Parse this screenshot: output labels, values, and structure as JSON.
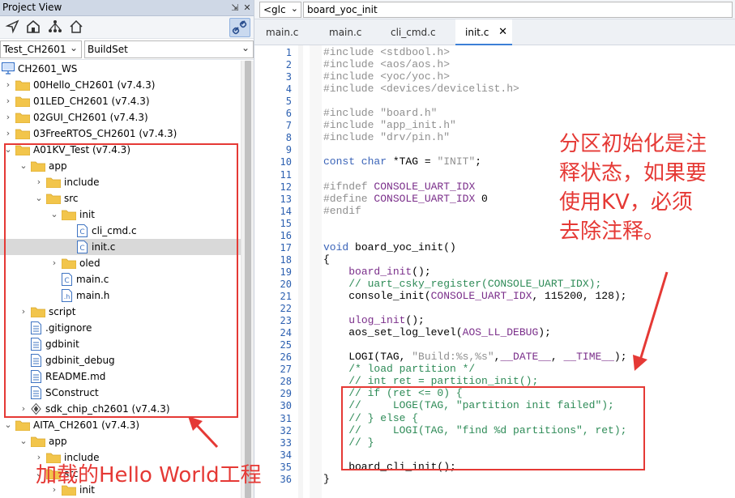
{
  "project_view": {
    "title": "Project View",
    "project_select": "Test_CH2601",
    "build_select": "BuildSet",
    "icons": [
      "pin-icon",
      "home-icon",
      "hierarchy-icon",
      "house-icon",
      "link-editor-icon"
    ]
  },
  "tree": [
    {
      "label": "CH2601_WS",
      "kind": "workspace",
      "depth": 0
    },
    {
      "label": "00Hello_CH2601 (v7.4.3)",
      "kind": "folder",
      "depth": 0,
      "expanded": false
    },
    {
      "label": "01LED_CH2601 (v7.4.3)",
      "kind": "folder",
      "depth": 0,
      "expanded": false
    },
    {
      "label": "02GUI_CH2601 (v7.4.3)",
      "kind": "folder",
      "depth": 0,
      "expanded": false
    },
    {
      "label": "03FreeRTOS_CH2601 (v7.4.3)",
      "kind": "folder",
      "depth": 0,
      "expanded": false
    },
    {
      "label": "A01KV_Test (v7.4.3)",
      "kind": "folder",
      "depth": 0,
      "expanded": true
    },
    {
      "label": "app",
      "kind": "folder",
      "depth": 1,
      "expanded": true
    },
    {
      "label": "include",
      "kind": "folder",
      "depth": 2,
      "expanded": false
    },
    {
      "label": "src",
      "kind": "folder",
      "depth": 2,
      "expanded": true
    },
    {
      "label": "init",
      "kind": "folder",
      "depth": 3,
      "expanded": true
    },
    {
      "label": "cli_cmd.c",
      "kind": "cfile",
      "depth": 4
    },
    {
      "label": "init.c",
      "kind": "cfile",
      "depth": 4,
      "selected": true
    },
    {
      "label": "oled",
      "kind": "folder",
      "depth": 3,
      "expanded": false
    },
    {
      "label": "main.c",
      "kind": "cfile",
      "depth": 3
    },
    {
      "label": "main.h",
      "kind": "hfile",
      "depth": 3
    },
    {
      "label": "script",
      "kind": "folder",
      "depth": 1,
      "expanded": false
    },
    {
      "label": ".gitignore",
      "kind": "text",
      "depth": 1
    },
    {
      "label": "gdbinit",
      "kind": "text",
      "depth": 1
    },
    {
      "label": "gdbinit_debug",
      "kind": "text",
      "depth": 1
    },
    {
      "label": "README.md",
      "kind": "text",
      "depth": 1
    },
    {
      "label": "SConstruct",
      "kind": "text",
      "depth": 1
    },
    {
      "label": "sdk_chip_ch2601 (v7.4.3)",
      "kind": "component",
      "depth": 1,
      "expanded": false
    },
    {
      "label": "AITA_CH2601 (v7.4.3)",
      "kind": "folder",
      "depth": 0,
      "expanded": true
    },
    {
      "label": "app",
      "kind": "folder",
      "depth": 1,
      "expanded": true
    },
    {
      "label": "include",
      "kind": "folder",
      "depth": 2,
      "expanded": false
    },
    {
      "label": "src",
      "kind": "folder",
      "depth": 2,
      "expanded": true
    },
    {
      "label": "init",
      "kind": "folder",
      "depth": 3,
      "expanded": false
    }
  ],
  "editor": {
    "symbol_select": "<glc",
    "function_path": "board_yoc_init",
    "tabs": [
      {
        "label": "main.c",
        "active": false
      },
      {
        "label": "main.c",
        "active": false
      },
      {
        "label": "cli_cmd.c",
        "active": false
      },
      {
        "label": "init.c",
        "active": true
      }
    ],
    "lines": [
      [
        [
          "pp",
          "#include <stdbool.h>"
        ]
      ],
      [
        [
          "pp",
          "#include <aos/aos.h>"
        ]
      ],
      [
        [
          "pp",
          "#include <yoc/yoc.h>"
        ]
      ],
      [
        [
          "pp",
          "#include <devices/devicelist.h>"
        ]
      ],
      [],
      [
        [
          "pp",
          "#include "
        ],
        [
          "str",
          "\"board.h\""
        ]
      ],
      [
        [
          "pp",
          "#include "
        ],
        [
          "str",
          "\"app_init.h\""
        ]
      ],
      [
        [
          "pp",
          "#include "
        ],
        [
          "str",
          "\"drv/pin.h\""
        ]
      ],
      [],
      [
        [
          "kw",
          "const char"
        ],
        [
          "plain",
          " *TAG = "
        ],
        [
          "str",
          "\"INIT\""
        ],
        [
          "plain",
          ";"
        ]
      ],
      [],
      [
        [
          "pp",
          "#ifndef "
        ],
        [
          "mac",
          "CONSOLE_UART_IDX"
        ]
      ],
      [
        [
          "pp",
          "#define "
        ],
        [
          "mac",
          "CONSOLE_UART_IDX"
        ],
        [
          "plain",
          " 0"
        ]
      ],
      [
        [
          "pp",
          "#endif"
        ]
      ],
      [],
      [],
      [
        [
          "kw",
          "void"
        ],
        [
          "plain",
          " board_yoc_init()"
        ]
      ],
      [
        [
          "plain",
          "{"
        ]
      ],
      [
        [
          "plain",
          "    "
        ],
        [
          "mac",
          "board_init"
        ],
        [
          "plain",
          "();"
        ]
      ],
      [
        [
          "cm",
          "    // uart_csky_register(CONSOLE_UART_IDX);"
        ]
      ],
      [
        [
          "plain",
          "    console_init("
        ],
        [
          "mac",
          "CONSOLE_UART_IDX"
        ],
        [
          "plain",
          ", 115200, 128);"
        ]
      ],
      [],
      [
        [
          "plain",
          "    "
        ],
        [
          "mac",
          "ulog_init"
        ],
        [
          "plain",
          "();"
        ]
      ],
      [
        [
          "plain",
          "    aos_set_log_level("
        ],
        [
          "mac",
          "AOS_LL_DEBUG"
        ],
        [
          "plain",
          ");"
        ]
      ],
      [],
      [
        [
          "plain",
          "    LOGI(TAG, "
        ],
        [
          "str",
          "\"Build:%s,%s\""
        ],
        [
          "plain",
          ","
        ],
        [
          "mac",
          "__DATE__"
        ],
        [
          "plain",
          ", "
        ],
        [
          "mac",
          "__TIME__"
        ],
        [
          "plain",
          ");"
        ]
      ],
      [
        [
          "cm",
          "    /* load partition */"
        ]
      ],
      [
        [
          "cm",
          "    // int ret = partition_init();"
        ]
      ],
      [
        [
          "cm",
          "    // if (ret <= 0) {"
        ]
      ],
      [
        [
          "cm",
          "    //     LOGE(TAG, \"partition init failed\");"
        ]
      ],
      [
        [
          "cm",
          "    // } else {"
        ]
      ],
      [
        [
          "cm",
          "    //     LOGI(TAG, \"find %d partitions\", ret);"
        ]
      ],
      [
        [
          "cm",
          "    // }"
        ]
      ],
      [],
      [
        [
          "plain",
          "    board_cli_init();"
        ]
      ],
      [
        [
          "plain",
          "}"
        ]
      ]
    ]
  },
  "annotations": {
    "right_note": "分区初始化是注释状态，如果要使用KV，必须去除注释。",
    "right_note_lines": [
      "分区初始化是注",
      "释状态，如果要",
      "使用KV，必须",
      "去除注释。"
    ],
    "left_note": "加载的Hello World工程",
    "color": "#e53935"
  }
}
